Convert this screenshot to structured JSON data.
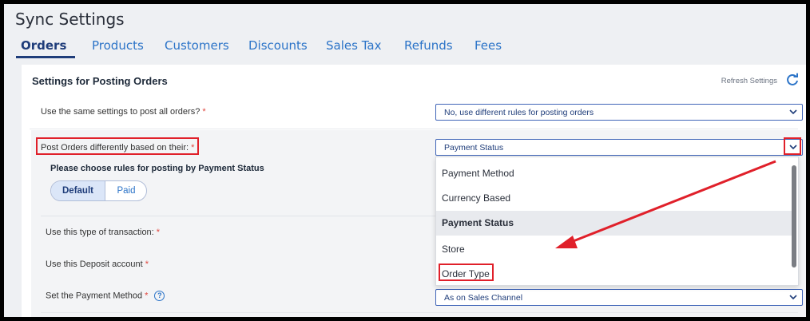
{
  "page": {
    "title": "Sync Settings"
  },
  "tabs": [
    {
      "label": "Orders",
      "active": true
    },
    {
      "label": "Products"
    },
    {
      "label": "Customers"
    },
    {
      "label": "Discounts"
    },
    {
      "label": "Sales Tax"
    },
    {
      "label": "Refunds"
    },
    {
      "label": "Fees"
    }
  ],
  "section": {
    "title": "Settings for Posting Orders",
    "refresh_label": "Refresh Settings",
    "refresh_icon": "refresh-icon"
  },
  "fields": {
    "same_settings": {
      "label": "Use the same settings to post all orders?",
      "required": "*",
      "value": "No, use different rules for posting orders"
    },
    "post_based_on": {
      "label": "Post Orders differently based on their:",
      "required": "*",
      "value": "Payment Status"
    },
    "transaction_type": {
      "label": "Use this type of transaction:",
      "required": "*"
    },
    "deposit_account": {
      "label": "Use this Deposit account",
      "required": "*"
    },
    "payment_method": {
      "label": "Set the Payment Method",
      "required": "*",
      "help_icon": "?",
      "value": "As on Sales Channel"
    }
  },
  "rules": {
    "title": "Please choose rules for posting by Payment Status",
    "options": [
      "Default",
      "Paid"
    ],
    "selected": "Default"
  },
  "dropdown": {
    "items": [
      "Payment Method",
      "Currency Based",
      "Payment Status",
      "Store",
      "Order Type"
    ],
    "selected": "Payment Status",
    "highlighted": "Order Type"
  },
  "colors": {
    "accent": "#1f3d7a",
    "link": "#2c74c8",
    "highlight": "#e0202a",
    "required": "#e0463e"
  }
}
